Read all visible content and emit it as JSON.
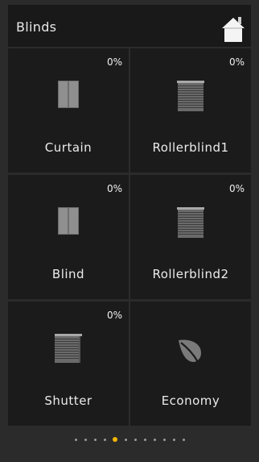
{
  "header": {
    "title": "Blinds",
    "home_icon": "home-icon"
  },
  "tiles": [
    {
      "label": "Curtain",
      "percent": "0%",
      "icon": "curtain-icon"
    },
    {
      "label": "Rollerblind1",
      "percent": "0%",
      "icon": "rollerblind-icon"
    },
    {
      "label": "Blind",
      "percent": "0%",
      "icon": "curtain-icon"
    },
    {
      "label": "Rollerblind2",
      "percent": "0%",
      "icon": "rollerblind-icon"
    },
    {
      "label": "Shutter",
      "percent": "0%",
      "icon": "shutter-icon"
    },
    {
      "label": "Economy",
      "percent": "",
      "icon": "leaf-icon"
    }
  ],
  "pagination": {
    "total": 12,
    "active_index": 4,
    "active_color": "#f2b705"
  }
}
